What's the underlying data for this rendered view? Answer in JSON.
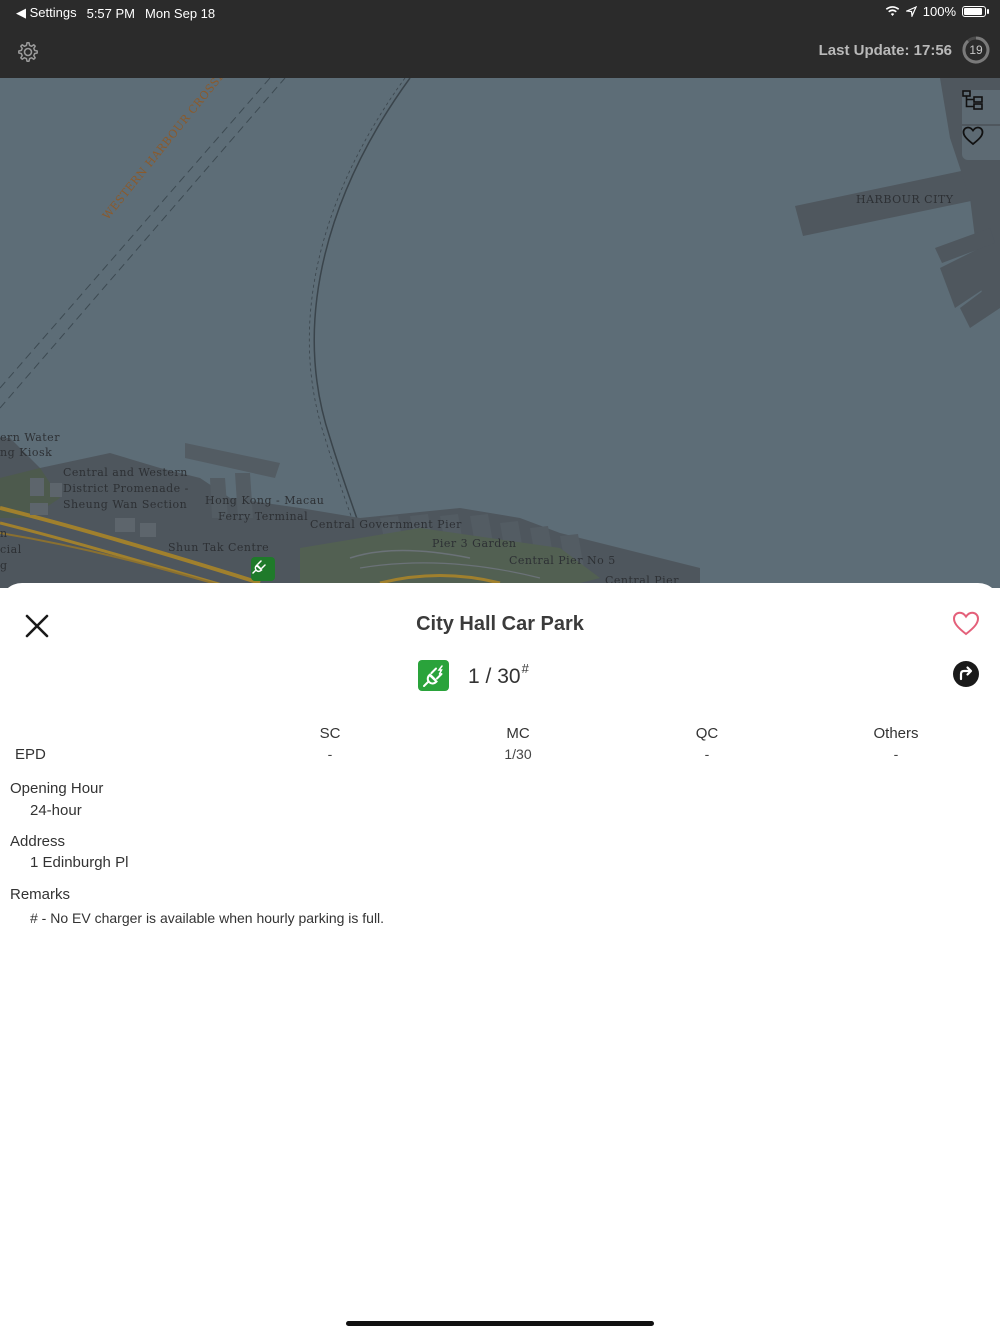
{
  "status_bar": {
    "back_app": "◀ Settings",
    "time": "5:57 PM",
    "date": "Mon Sep 18",
    "battery": "100%",
    "battery_level": 1.0
  },
  "header": {
    "last_update": "Last Update: 17:56",
    "refresh_countdown": "19"
  },
  "map": {
    "labels": {
      "western_harbour_crossing": "WESTERN HARBOUR CROSSING",
      "harbour_city": "HARBOUR CITY",
      "ern_water": "ern Water",
      "ng_kiosk": "ng Kiosk",
      "promenade_1": "Central and Western",
      "promenade_2": "District Promenade -",
      "promenade_3": "Sheung Wan Section",
      "ferry_1": "Hong Kong - Macau",
      "ferry_2": "Ferry Terminal",
      "central_gov_pier": "Central Government Pier",
      "shun_tak": "Shun Tak Centre",
      "pier3": "Pier 3 Garden",
      "pier5": "Central Pier No 5",
      "central_pier": "Central Pier",
      "edge_n": "n",
      "edge_cial": "cial",
      "edge_g": "g"
    }
  },
  "sheet": {
    "title": "City Hall Car Park",
    "available": "1",
    "separator": "/",
    "total": "30",
    "footnote_mark": "#",
    "columns": [
      "SC",
      "MC",
      "QC",
      "Others"
    ],
    "row_label": "EPD",
    "row_values": [
      "-",
      "1/30",
      "-",
      "-"
    ],
    "opening_hour_label": "Opening Hour",
    "opening_hour_value": "24-hour",
    "address_label": "Address",
    "address_value": "1 Edinburgh Pl",
    "remarks_label": "Remarks",
    "remarks_value": "# - No EV charger is available when hourly parking is full."
  },
  "colors": {
    "ev_green": "#2aa33b",
    "heart_pink": "#e4607a",
    "header_bg": "#2b2b2b",
    "water": "#5d6d77"
  },
  "icons": {
    "gear": "gear-icon",
    "layers": "layers-icon",
    "heart": "heart-icon",
    "ev_plug": "ev-plug-icon",
    "close": "close-icon",
    "directions": "directions-icon"
  }
}
